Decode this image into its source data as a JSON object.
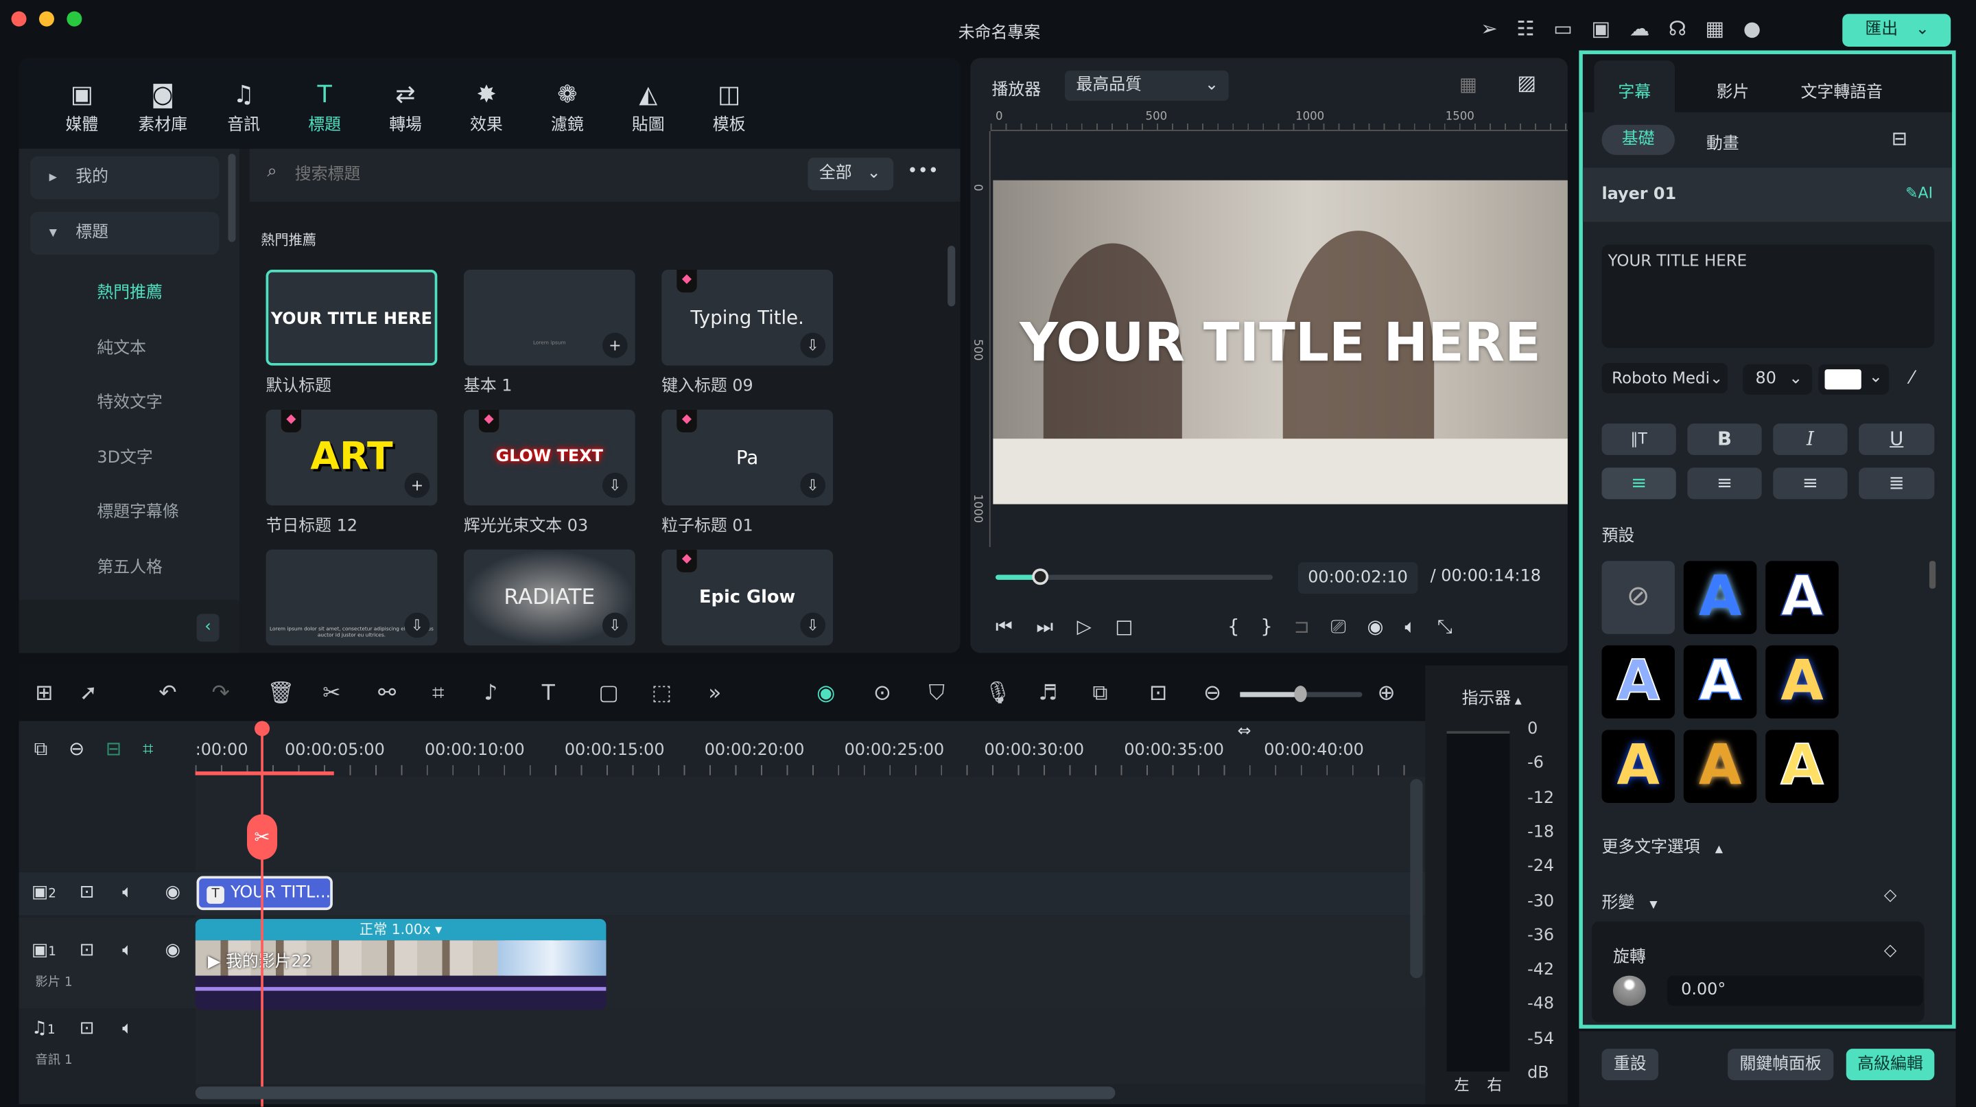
{
  "window": {
    "title": "未命名專案",
    "export_label": "匯出",
    "accent": "#4fe0c0"
  },
  "media_tabs": [
    {
      "label": "媒體",
      "icon": "media-icon"
    },
    {
      "label": "素材庫",
      "icon": "library-icon"
    },
    {
      "label": "音訊",
      "icon": "music-icon"
    },
    {
      "label": "標題",
      "icon": "title-icon",
      "active": true
    },
    {
      "label": "轉場",
      "icon": "transition-icon"
    },
    {
      "label": "效果",
      "icon": "effects-icon"
    },
    {
      "label": "濾鏡",
      "icon": "filter-icon"
    },
    {
      "label": "貼圖",
      "icon": "sticker-icon"
    },
    {
      "label": "模板",
      "icon": "template-icon"
    }
  ],
  "sidebar": {
    "groups": [
      {
        "label": "我的"
      },
      {
        "label": "標題"
      }
    ],
    "items": [
      {
        "label": "熱門推薦",
        "active": true
      },
      {
        "label": "純文本"
      },
      {
        "label": "特效文字"
      },
      {
        "label": "3D文字"
      },
      {
        "label": "標題字幕條"
      },
      {
        "label": "第五人格"
      }
    ]
  },
  "browser": {
    "search_placeholder": "搜索標題",
    "filter": "全部",
    "section": "熱門推薦",
    "cards": [
      {
        "preview": "YOUR TITLE HERE",
        "label": "默认标题"
      },
      {
        "preview": "Lorem ipsum",
        "label": "基本 1"
      },
      {
        "preview": "Typing Title.",
        "label": "键入标题 09"
      },
      {
        "preview": "ART",
        "label": "节日标题 12"
      },
      {
        "preview": "GLOW TEXT",
        "label": "辉光光束文本 03"
      },
      {
        "preview": "Pa",
        "label": "粒子标题 01"
      },
      {
        "preview": "Lorem ipsum dolor sit amet, consectetur adipiscing elit. Vivamus auctor id justor eu ultrices.",
        "label": ""
      },
      {
        "preview": "RADIATE",
        "label": ""
      },
      {
        "preview": "Epic Glow",
        "label": ""
      }
    ]
  },
  "player": {
    "label": "播放器",
    "quality": "最高品質",
    "ruler": [
      "0",
      "500",
      "1000",
      "1500"
    ],
    "vruler": [
      "0",
      "500",
      "1000"
    ],
    "overlay_title": "YOUR TITLE HERE",
    "current_time": "00:00:02:10",
    "total_time": "/ 00:00:14:18",
    "progress": 0.16
  },
  "inspector": {
    "tabs": [
      "字幕",
      "影片",
      "文字轉語音"
    ],
    "subtabs": [
      "基礎",
      "動畫"
    ],
    "layer": "layer 01",
    "text": "YOUR TITLE HERE",
    "font": "Roboto Medi",
    "size": "80",
    "color": "#ffffff",
    "style_buttons": [
      "B",
      "I",
      "U"
    ],
    "presets_label": "預設",
    "more_options": "更多文字選項",
    "transform": "形變",
    "rotate": "旋轉",
    "rotate_value": "0.00°",
    "reset": "重設",
    "keyframe_panel": "關鍵幀面板",
    "advanced": "高級編輯"
  },
  "timeline": {
    "ticks": [
      ":00:00",
      "00:00:05:00",
      "00:00:10:00",
      "00:00:15:00",
      "00:00:20:00",
      "00:00:25:00",
      "00:00:30:00",
      "00:00:35:00",
      "00:00:40:00"
    ],
    "tracks": [
      {
        "num": "2",
        "name": ""
      },
      {
        "num": "1",
        "name": "影片 1"
      },
      {
        "num": "1",
        "name": "音訊 1"
      }
    ],
    "title_clip": "YOUR TITL...",
    "video_clip": "我的影片22",
    "speed": "正常 1.00x",
    "meter_label": "指示器",
    "db_scale": [
      "0",
      "-6",
      "-12",
      "-18",
      "-24",
      "-30",
      "-36",
      "-42",
      "-48",
      "-54",
      "dB"
    ],
    "channels": [
      "左",
      "右"
    ]
  }
}
